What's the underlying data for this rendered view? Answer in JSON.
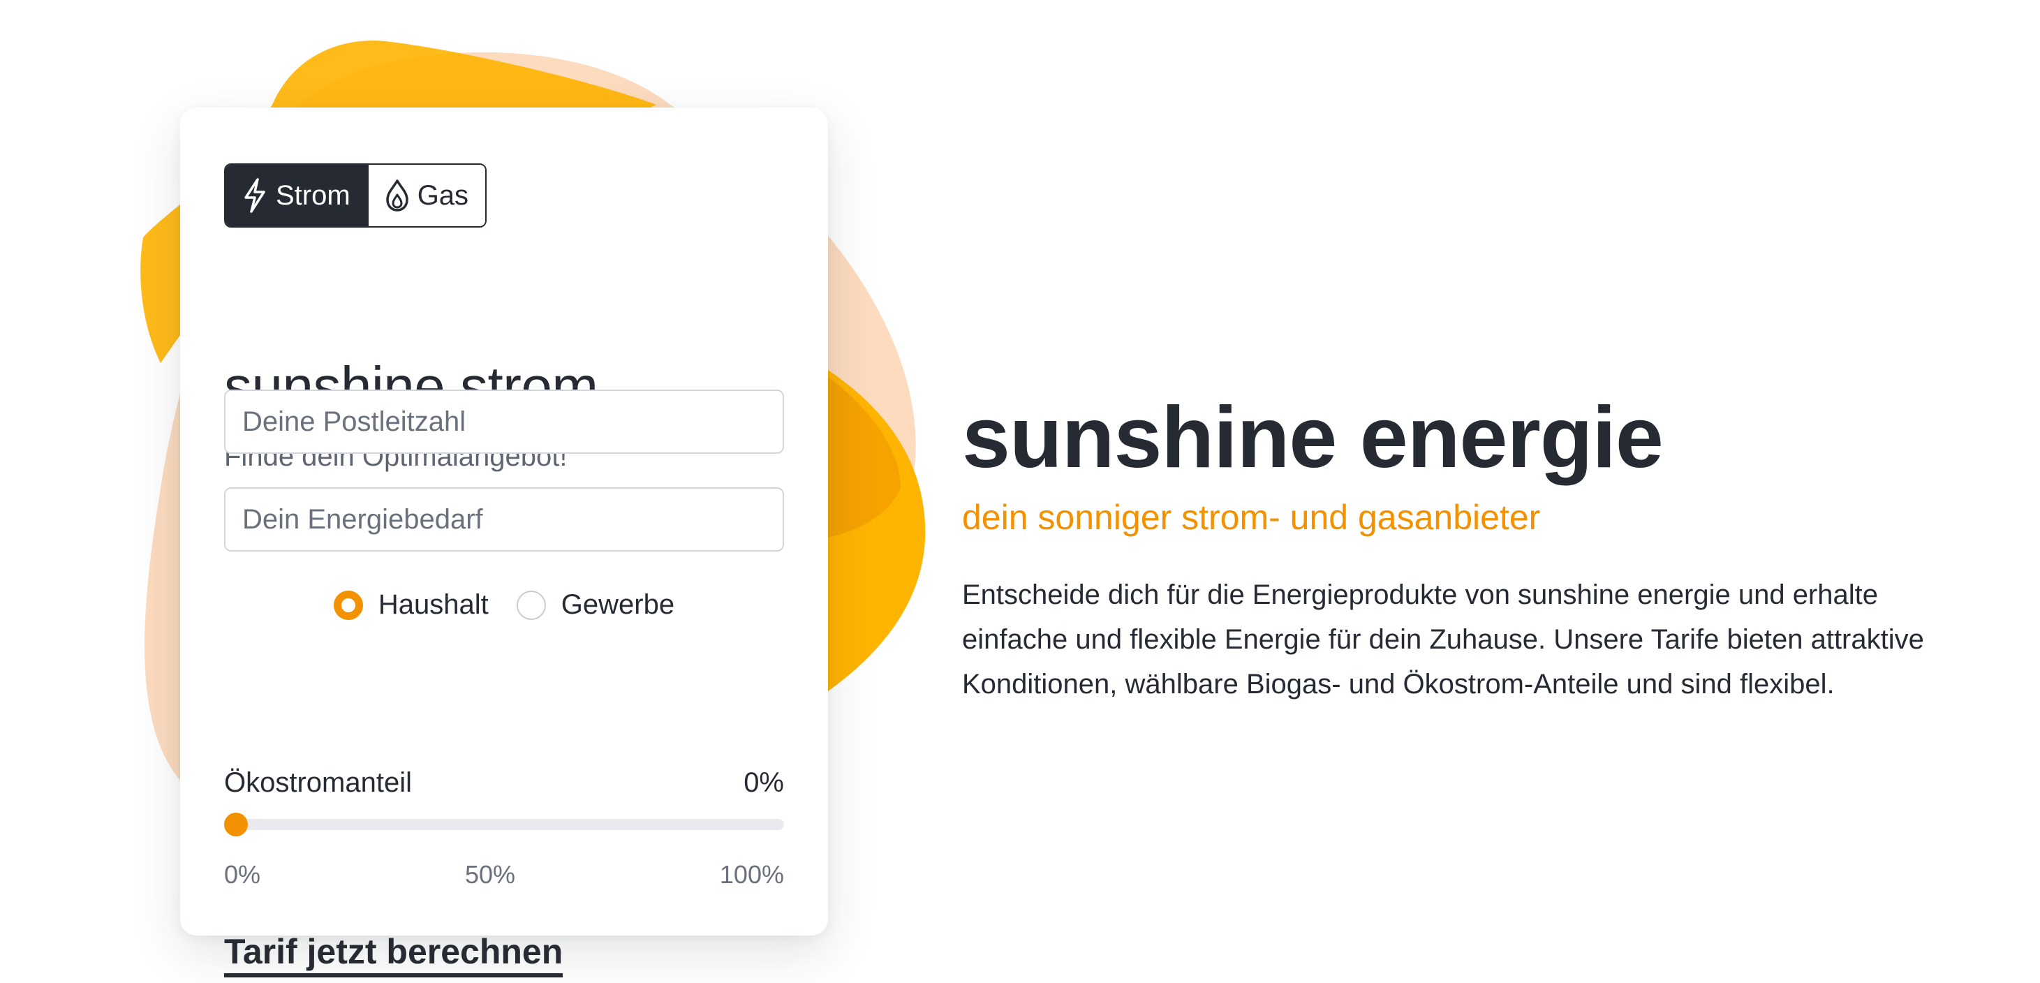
{
  "colors": {
    "accent": "#f39200",
    "dark": "#262b33",
    "blob_yellow": "#ffb400",
    "blob_peach": "#fcd7b8"
  },
  "calculator": {
    "tabs": [
      {
        "label": "Strom",
        "icon": "lightning-icon",
        "active": true
      },
      {
        "label": "Gas",
        "icon": "flame-drop-icon",
        "active": false
      }
    ],
    "title": "sunshine strom",
    "subtitle": "Finde dein Optimalangebot!",
    "zip_field": {
      "placeholder": "Deine Postleitzahl",
      "value": ""
    },
    "energy_field": {
      "placeholder": "Dein Energiebedarf",
      "value": ""
    },
    "customer_type": {
      "options": [
        "Haushalt",
        "Gewerbe"
      ],
      "selected": "Haushalt"
    },
    "eco_share": {
      "label": "Ökostromanteil",
      "value_text": "0%",
      "value_percent": 0,
      "ticks": [
        "0%",
        "50%",
        "100%"
      ]
    },
    "cta_label": "Tarif jetzt berechnen"
  },
  "hero": {
    "title": "sunshine energie",
    "subtitle": "dein sonniger strom- und gasanbieter",
    "body": "Entscheide dich für die Energieprodukte von sunshine energie und erhalte einfache und flexible Energie für dein Zuhause. Unsere Tarife bieten attraktive Konditionen, wählbare Biogas- und Ökostrom-Anteile und sind flexibel."
  }
}
